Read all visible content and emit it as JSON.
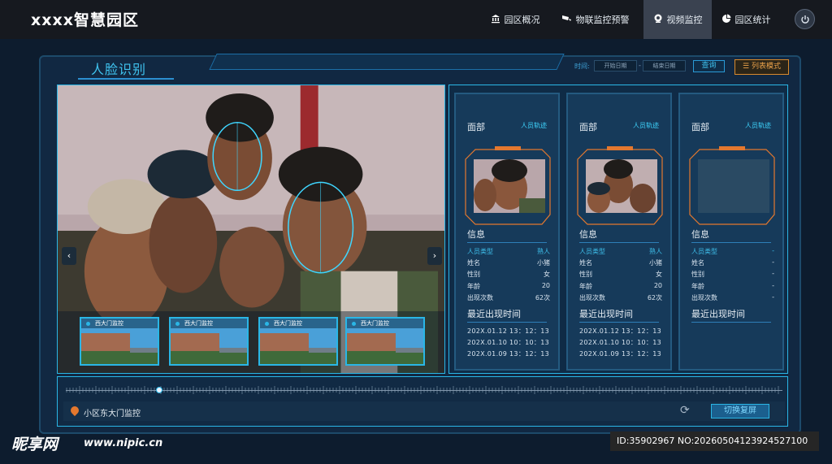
{
  "header": {
    "title": "xxxx智慧园区",
    "nav": [
      {
        "label": "园区概况",
        "icon": "building-icon"
      },
      {
        "label": "物联监控预警",
        "icon": "camera-icon"
      },
      {
        "label": "视频监控",
        "icon": "video-icon"
      },
      {
        "label": "园区统计",
        "icon": "pie-chart-icon"
      }
    ],
    "active_nav": "视频监控",
    "power_icon": "power-icon"
  },
  "section": {
    "title": "人脸识别",
    "time_label": "时间:",
    "start_placeholder": "开始日期",
    "end_placeholder": "结束日期",
    "date_separator": "-",
    "query_label": "查询",
    "list_mode_label": "列表模式"
  },
  "video": {
    "thumbs": [
      {
        "label": "西大门监控"
      },
      {
        "label": "西大门监控"
      },
      {
        "label": "西大门监控"
      },
      {
        "label": "西大门监控"
      }
    ]
  },
  "cards": [
    {
      "face_label": "面部",
      "track_link": "人员轨迹",
      "info_title": "信息",
      "fields": [
        {
          "label": "人员类型",
          "value": "熟人"
        },
        {
          "label": "姓名",
          "value": "小猪"
        },
        {
          "label": "性别",
          "value": "女"
        },
        {
          "label": "年龄",
          "value": "20"
        },
        {
          "label": "出现次数",
          "value": "62次"
        }
      ],
      "recent_title": "最近出现时间",
      "times": [
        "202X.01.12 13：12：13",
        "202X.01.10 10：10：13",
        "202X.01.09 13：12：13"
      ]
    },
    {
      "face_label": "面部",
      "track_link": "人员轨迹",
      "info_title": "信息",
      "fields": [
        {
          "label": "人员类型",
          "value": "熟人"
        },
        {
          "label": "姓名",
          "value": "小猪"
        },
        {
          "label": "性别",
          "value": "女"
        },
        {
          "label": "年龄",
          "value": "20"
        },
        {
          "label": "出现次数",
          "value": "62次"
        }
      ],
      "recent_title": "最近出现时间",
      "times": [
        "202X.01.12 13：12：13",
        "202X.01.10 10：10：13",
        "202X.01.09 13：12：13"
      ]
    },
    {
      "face_label": "面部",
      "track_link": "人员轨迹",
      "info_title": "信息",
      "fields": [
        {
          "label": "人员类型",
          "value": "-"
        },
        {
          "label": "姓名",
          "value": "-"
        },
        {
          "label": "性别",
          "value": "-"
        },
        {
          "label": "年龄",
          "value": "-"
        },
        {
          "label": "出现次数",
          "value": "-"
        }
      ],
      "recent_title": "最近出现时间",
      "times": []
    }
  ],
  "bottom": {
    "camera_name": "小区东大门监控",
    "switch_label": "切换复屏",
    "playback_position": 0.13
  },
  "watermark": {
    "site": "昵享网",
    "url": "www.nipic.cn",
    "id_text": "ID:35902967 NO:20260504123924527100"
  },
  "colors": {
    "accent": "#2ab6e6",
    "title": "#3fc2ee",
    "warning": "#d98a2c",
    "bg": "#0d1c2e"
  }
}
